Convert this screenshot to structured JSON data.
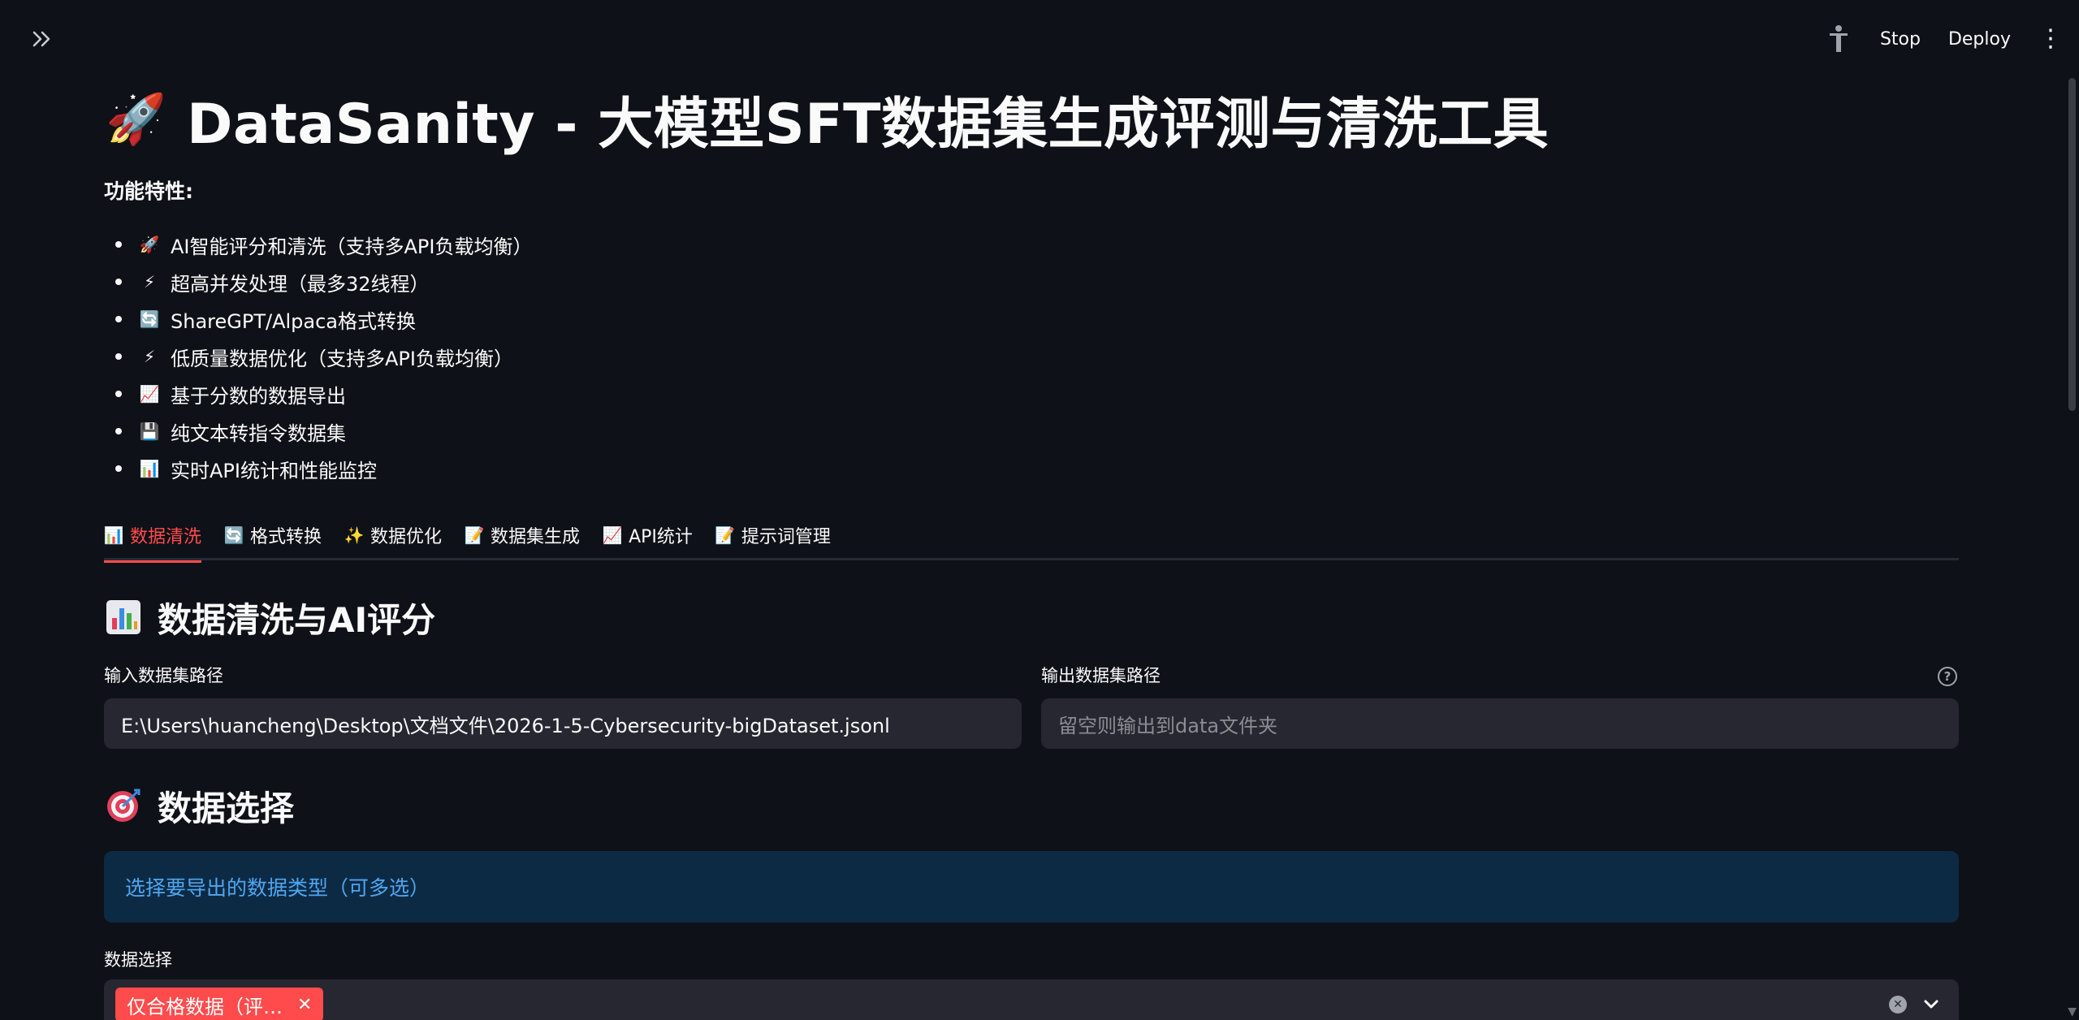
{
  "topbar": {
    "stop_label": "Stop",
    "deploy_label": "Deploy"
  },
  "page": {
    "title": "DataSanity - 大模型SFT数据集生成评测与清洗工具",
    "features_label": "功能特性:",
    "features": [
      {
        "icon": "rocket-icon",
        "glyph": "🚀",
        "text": "AI智能评分和清洗（支持多API负载均衡）"
      },
      {
        "icon": "lightning-icon",
        "glyph": "⚡",
        "text": "超高并发处理（最多32线程）"
      },
      {
        "icon": "refresh-icon",
        "glyph": "🔄",
        "text": "ShareGPT/Alpaca格式转换"
      },
      {
        "icon": "lightning-icon",
        "glyph": "⚡",
        "text": "低质量数据优化（支持多API负载均衡）"
      },
      {
        "icon": "chart-increasing-icon",
        "glyph": "📈",
        "text": "基于分数的数据导出"
      },
      {
        "icon": "floppy-disk-icon",
        "glyph": "💾",
        "text": "纯文本转指令数据集"
      },
      {
        "icon": "bar-chart-icon",
        "glyph": "📊",
        "text": "实时API统计和性能监控"
      }
    ]
  },
  "tabs": [
    {
      "icon": "bar-chart-icon",
      "glyph": "📊",
      "label": "数据清洗",
      "active": true
    },
    {
      "icon": "refresh-icon",
      "glyph": "🔄",
      "label": "格式转换",
      "active": false
    },
    {
      "icon": "sparkles-icon",
      "glyph": "✨",
      "label": "数据优化",
      "active": false
    },
    {
      "icon": "memo-icon",
      "glyph": "📝",
      "label": "数据集生成",
      "active": false
    },
    {
      "icon": "chart-increasing-icon",
      "glyph": "📈",
      "label": "API统计",
      "active": false
    },
    {
      "icon": "memo-icon",
      "glyph": "📝",
      "label": "提示词管理",
      "active": false
    }
  ],
  "cleaning": {
    "heading": "数据清洗与AI评分",
    "input_label": "输入数据集路径",
    "input_value": "E:\\Users\\huancheng\\Desktop\\文档文件\\2026-1-5-Cybersecurity-bigDataset.jsonl",
    "output_label": "输出数据集路径",
    "output_placeholder": "留空则输出到data文件夹"
  },
  "selection": {
    "heading": "数据选择",
    "info": "选择要导出的数据类型（可多选）",
    "select_label": "数据选择",
    "chip_label": "仅合格数据（评…"
  },
  "colors": {
    "background": "#0e1117",
    "accent": "#ff4b4b",
    "input_bg": "#262730",
    "info_bg": "#0d2a45",
    "info_text": "#4fa6f0"
  }
}
